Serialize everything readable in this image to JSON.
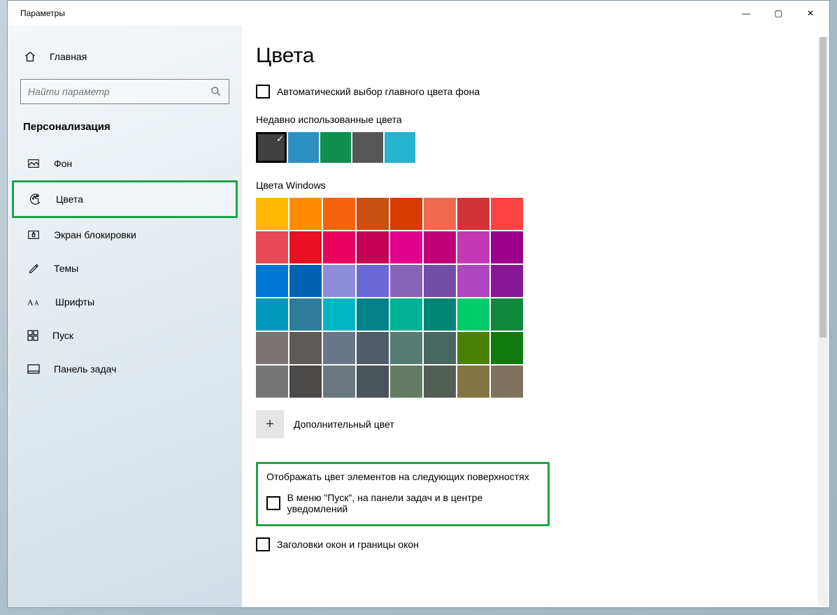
{
  "window": {
    "title": "Параметры",
    "minimize": "—",
    "maximize": "▢",
    "close": "✕"
  },
  "sidebar": {
    "home_label": "Главная",
    "search_placeholder": "Найти параметр",
    "category": "Персонализация",
    "items": [
      {
        "label": "Фон",
        "icon": "image-icon"
      },
      {
        "label": "Цвета",
        "icon": "palette-icon",
        "active": true
      },
      {
        "label": "Экран блокировки",
        "icon": "lock-screen-icon"
      },
      {
        "label": "Темы",
        "icon": "themes-icon"
      },
      {
        "label": "Шрифты",
        "icon": "fonts-icon"
      },
      {
        "label": "Пуск",
        "icon": "start-icon"
      },
      {
        "label": "Панель задач",
        "icon": "taskbar-icon"
      }
    ]
  },
  "page": {
    "title": "Цвета",
    "auto_pick_label": "Автоматический выбор главного цвета фона",
    "recent_label": "Недавно использованные цвета",
    "recent_colors": [
      "#414141",
      "#2e90c1",
      "#0f8e4d",
      "#575757",
      "#26b3ce"
    ],
    "windows_colors_label": "Цвета Windows",
    "windows_colors": [
      "#ffb900",
      "#ff8c00",
      "#f7630c",
      "#ca5010",
      "#da3b01",
      "#ef6950",
      "#d13438",
      "#ff4343",
      "#e74856",
      "#e81123",
      "#ea005e",
      "#c30052",
      "#e3008c",
      "#bf0077",
      "#c239b3",
      "#9a0089",
      "#0078d7",
      "#0063b1",
      "#8e8cd8",
      "#6b69d6",
      "#8764b8",
      "#744da9",
      "#b146c2",
      "#881798",
      "#0099bc",
      "#2d7d9a",
      "#00b7c3",
      "#038387",
      "#00b294",
      "#018574",
      "#00cc6a",
      "#10893e",
      "#7a7574",
      "#5d5a58",
      "#68768a",
      "#515c6b",
      "#567c73",
      "#486860",
      "#498205",
      "#107c10",
      "#767676",
      "#4c4a48",
      "#69797e",
      "#4a5459",
      "#647c64",
      "#525e54",
      "#847545",
      "#7e735f"
    ],
    "additional_label": "Дополнительный цвет",
    "surfaces_title": "Отображать цвет элементов на следующих поверхностях",
    "surfaces_start_label": "В меню \"Пуск\", на панели задач и в центре уведомлений",
    "titlebars_label": "Заголовки окон и границы окон"
  }
}
